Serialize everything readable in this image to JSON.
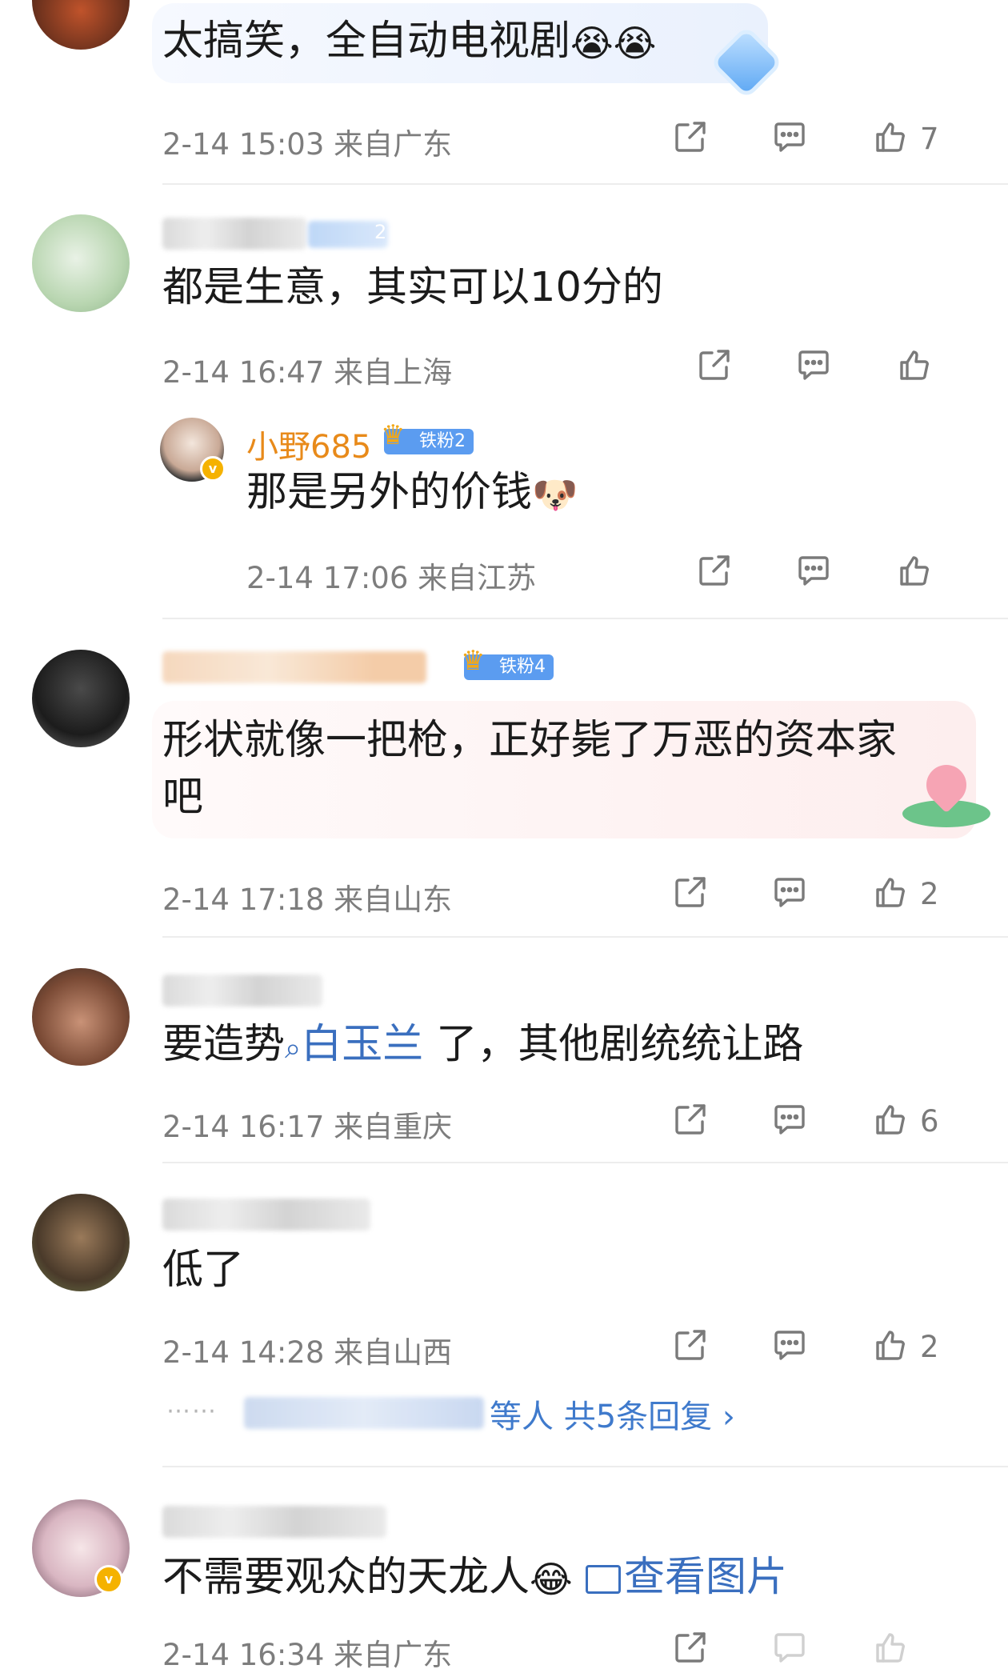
{
  "comments": [
    {
      "text": "太搞笑，全自动电视剧",
      "emoji": "😭😭",
      "date": "2-14 15:03",
      "location": "来自广东",
      "likes": "7"
    },
    {
      "badge_level": "2",
      "text": "都是生意，其实可以10分的",
      "date": "2-14 16:47",
      "location": "来自上海",
      "likes": "",
      "reply": {
        "username": "小野685",
        "badge": "铁粉2",
        "text": "那是另外的价钱",
        "emoji": "🐶",
        "date": "2-14 17:06",
        "location": "来自江苏",
        "likes": ""
      }
    },
    {
      "badge": "铁粉4",
      "text_line1": "形状就像一把枪，正好毙了万恶的资本家",
      "text_line2": "吧",
      "date": "2-14 17:18",
      "location": "来自山东",
      "likes": "2"
    },
    {
      "text_before": "要造势",
      "link": "白玉兰",
      "text_after": " 了，其他剧统统让路",
      "date": "2-14 16:17",
      "location": "来自重庆",
      "likes": "6"
    },
    {
      "text": "低了",
      "date": "2-14 14:28",
      "location": "来自山西",
      "likes": "2",
      "more_replies_people": "等人",
      "more_replies_count": "共5条回复 ›"
    },
    {
      "text": "不需要观众的天龙人",
      "emoji": "😂",
      "image_link": "查看图片",
      "date": "2-14 16:34",
      "location": "来自广东"
    }
  ],
  "colors": {
    "link": "#3a6fbf",
    "username": "#e88a1a",
    "badge": "#5b9cf0",
    "meta": "#7d7d7d"
  }
}
